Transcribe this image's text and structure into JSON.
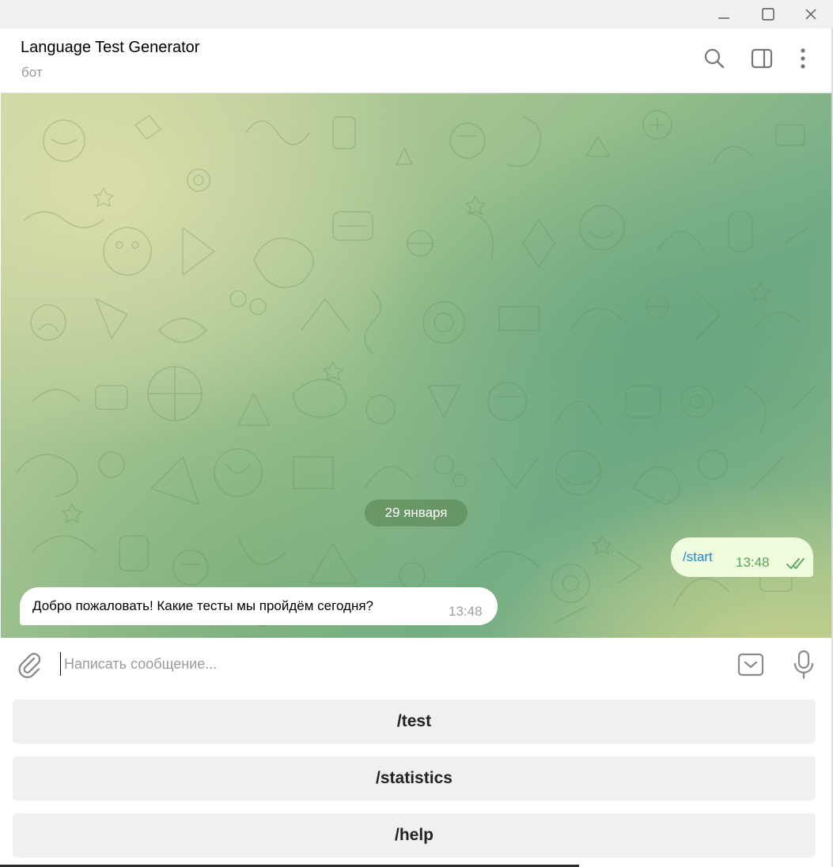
{
  "window": {
    "controls": {
      "minimize_icon": "minimize-icon",
      "maximize_icon": "maximize-icon",
      "close_icon": "close-icon"
    }
  },
  "header": {
    "title": "Language Test Generator",
    "subtitle": "бот",
    "icons": [
      "search-icon",
      "sidebar-toggle-icon",
      "more-vertical-icon"
    ]
  },
  "chat": {
    "date_separator": "29 января",
    "messages": [
      {
        "direction": "outgoing",
        "text": "/start",
        "time": "13:48",
        "status": "read"
      },
      {
        "direction": "incoming",
        "text": "Добро пожаловать! Какие тесты мы пройдём сегодня?",
        "time": "13:48"
      }
    ]
  },
  "composer": {
    "placeholder": "Написать сообщение...",
    "value": "",
    "icons": [
      "paperclip-icon",
      "keyboard-toggle-icon",
      "microphone-icon"
    ]
  },
  "bot_keyboard": {
    "buttons": [
      {
        "label": "/test"
      },
      {
        "label": "/statistics"
      },
      {
        "label": "/help"
      }
    ]
  },
  "colors": {
    "outgoing_bubble": "#eefbdc",
    "link_command": "#2a86c9",
    "read_checks": "#5aa45b",
    "keyboard_button": "#f0f0f0"
  }
}
